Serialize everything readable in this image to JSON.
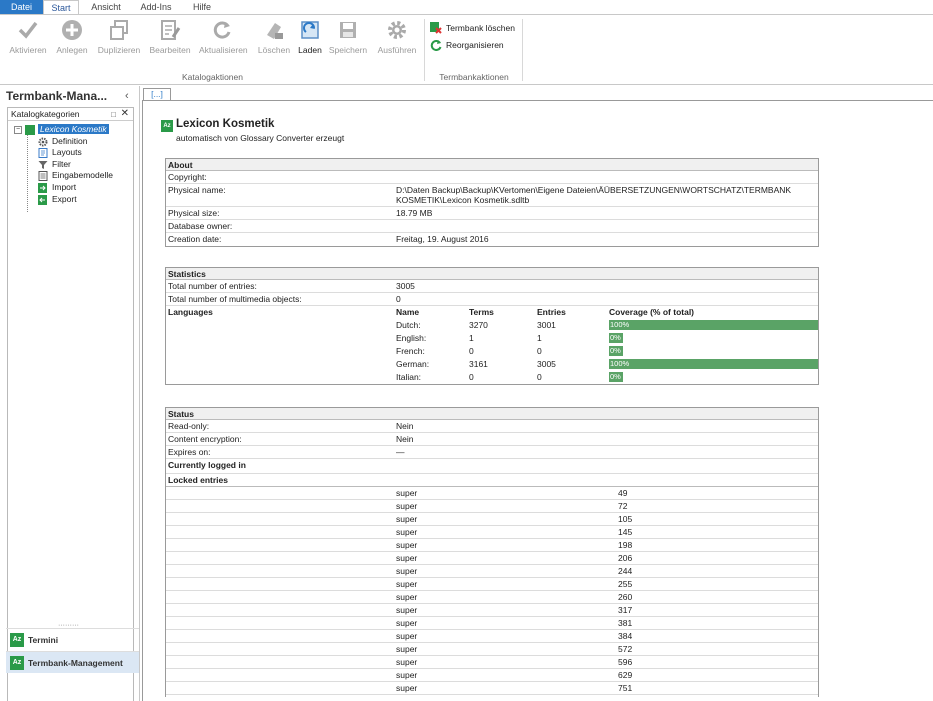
{
  "ribbon": {
    "tabs": [
      "Datei",
      "Start",
      "Ansicht",
      "Add-Ins",
      "Hilfe"
    ],
    "catalog_buttons": [
      "Aktivieren",
      "Anlegen",
      "Duplizieren",
      "Bearbeiten",
      "Aktualisieren",
      "Löschen",
      "Laden",
      "Speichern",
      "Ausführen"
    ],
    "catalog_group": "Katalogaktionen",
    "termbank_buttons": [
      "Termbank löschen",
      "Reorganisieren"
    ],
    "termbank_group": "Termbankaktionen"
  },
  "nav": {
    "title": "Termbank-Mana...",
    "collapse_icon": "chevron-left-icon",
    "category_header": "Katalogkategorien",
    "pin_icon": "pin-icon",
    "close_icon": "close-icon",
    "root": "Lexicon Kosmetik",
    "children": [
      "Definition",
      "Layouts",
      "Filter",
      "Eingabemodelle",
      "Import",
      "Export"
    ],
    "dots": "·········",
    "bottom": [
      "Termini",
      "Termbank-Management"
    ]
  },
  "doc": {
    "tab": "[...]",
    "title": "Lexicon Kosmetik",
    "subtitle": "automatisch von Glossary Converter erzeugt"
  },
  "about": {
    "header": "About",
    "rows": [
      {
        "k": "Copyright:",
        "v": ""
      },
      {
        "k": "Physical name:",
        "v": "D:\\Daten Backup\\Backup\\KVertomen\\Eigene Dateien\\ÄÜBERSETZUNGEN\\WORTSCHATZ\\TERMBANK KOSMETIK\\Lexicon Kosmetik.sdltb"
      },
      {
        "k": "Physical size:",
        "v": "18.79 MB"
      },
      {
        "k": "Database owner:",
        "v": ""
      },
      {
        "k": "Creation date:",
        "v": "Freitag, 19. August 2016"
      }
    ]
  },
  "statistics": {
    "header": "Statistics",
    "total_entries_label": "Total number of entries:",
    "total_entries": "3005",
    "total_media_label": "Total number of multimedia objects:",
    "total_media": "0",
    "languages_label": "Languages",
    "columns": [
      "Name",
      "Terms",
      "Entries",
      "Coverage (% of total)"
    ],
    "languages": [
      {
        "name": "Dutch:",
        "terms": "3270",
        "entries": "3001",
        "coverage": "100%",
        "fill": 1.0
      },
      {
        "name": "English:",
        "terms": "1",
        "entries": "1",
        "coverage": "0%",
        "fill": 0.0
      },
      {
        "name": "French:",
        "terms": "0",
        "entries": "0",
        "coverage": "0%",
        "fill": 0.0
      },
      {
        "name": "German:",
        "terms": "3161",
        "entries": "3005",
        "coverage": "100%",
        "fill": 1.0
      },
      {
        "name": "Italian:",
        "terms": "0",
        "entries": "0",
        "coverage": "0%",
        "fill": 0.0
      }
    ]
  },
  "status": {
    "header": "Status",
    "rows": [
      {
        "k": "Read-only:",
        "v": "Nein"
      },
      {
        "k": "Content encryption:",
        "v": "Nein"
      },
      {
        "k": "Expires on:",
        "v": "—"
      }
    ],
    "logged_in_label": "Currently logged in",
    "locked_label": "Locked entries",
    "locked": [
      {
        "user": "super",
        "id": "49"
      },
      {
        "user": "super",
        "id": "72"
      },
      {
        "user": "super",
        "id": "105"
      },
      {
        "user": "super",
        "id": "145"
      },
      {
        "user": "super",
        "id": "198"
      },
      {
        "user": "super",
        "id": "206"
      },
      {
        "user": "super",
        "id": "244"
      },
      {
        "user": "super",
        "id": "255"
      },
      {
        "user": "super",
        "id": "260"
      },
      {
        "user": "super",
        "id": "317"
      },
      {
        "user": "super",
        "id": "381"
      },
      {
        "user": "super",
        "id": "384"
      },
      {
        "user": "super",
        "id": "572"
      },
      {
        "user": "super",
        "id": "596"
      },
      {
        "user": "super",
        "id": "629"
      },
      {
        "user": "super",
        "id": "751"
      }
    ]
  },
  "colors": {
    "accent": "#2b79c7",
    "coverage": "#5aa366",
    "termbank_green": "#2a9a48"
  }
}
